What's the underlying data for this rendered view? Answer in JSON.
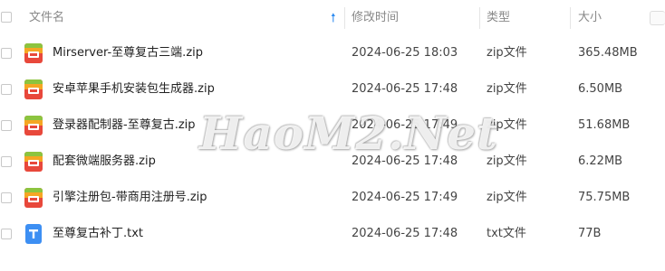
{
  "header": {
    "name": "文件名",
    "modified": "修改时间",
    "type": "类型",
    "size": "大小",
    "sort_icon": "arrow-up-icon"
  },
  "files": [
    {
      "name": "Mirserver-至尊复古三端.zip",
      "date": "2024-06-25 18:03",
      "type": "zip文件",
      "size": "365.48MB",
      "icon": "zip-icon"
    },
    {
      "name": "安卓苹果手机安装包生成器.zip",
      "date": "2024-06-25 17:48",
      "type": "zip文件",
      "size": "6.50MB",
      "icon": "zip-icon"
    },
    {
      "name": "登录器配制器-至尊复古.zip",
      "date": "2024-06-25 17:49",
      "type": "zip文件",
      "size": "51.68MB",
      "icon": "zip-icon"
    },
    {
      "name": "配套微端服务器.zip",
      "date": "2024-06-25 17:48",
      "type": "zip文件",
      "size": "6.22MB",
      "icon": "zip-icon"
    },
    {
      "name": "引擎注册包-带商用注册号.zip",
      "date": "2024-06-25 17:49",
      "type": "zip文件",
      "size": "75.75MB",
      "icon": "zip-icon"
    },
    {
      "name": "至尊复古补丁.txt",
      "date": "2024-06-25 17:48",
      "type": "txt文件",
      "size": "77B",
      "icon": "txt-icon"
    }
  ],
  "watermark": "HaoM2.Net",
  "colors": {
    "accent": "#2e8bf0",
    "zip_top": "#8cc43f",
    "zip_mid": "#f5a623",
    "zip_bottom": "#e8483b",
    "txt": "#3d8ff3"
  }
}
